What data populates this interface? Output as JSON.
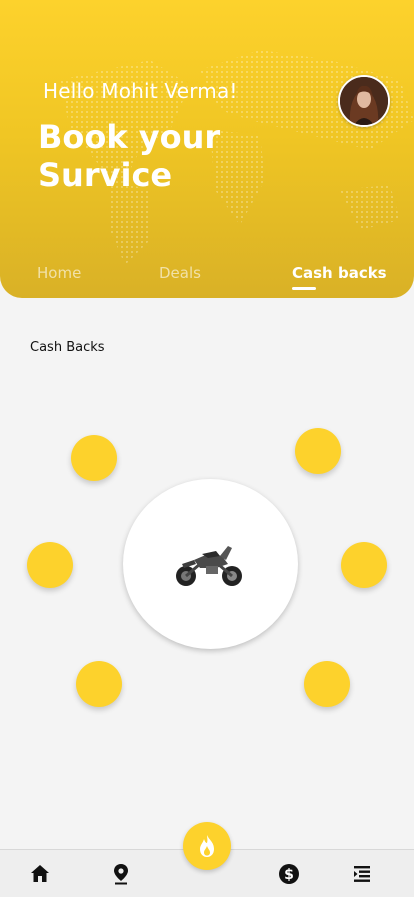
{
  "header": {
    "greeting": "Hello Mohit Verma!",
    "headline": "Book your Survice",
    "tabs": [
      {
        "label": "Home"
      },
      {
        "label": "Deals"
      },
      {
        "label": "Cash backs"
      }
    ],
    "active_tab": "Cash backs"
  },
  "section": {
    "title": "Cash Backs"
  },
  "colors": {
    "accent": "#fdd22c",
    "header_bottom": "#d9b126",
    "background": "#f4f4f4"
  },
  "bottom_nav": {
    "items": [
      {
        "icon": "home-icon"
      },
      {
        "icon": "location-pin-icon"
      },
      {
        "icon": "flame-icon"
      },
      {
        "icon": "dollar-icon"
      },
      {
        "icon": "menu-icon"
      }
    ]
  }
}
